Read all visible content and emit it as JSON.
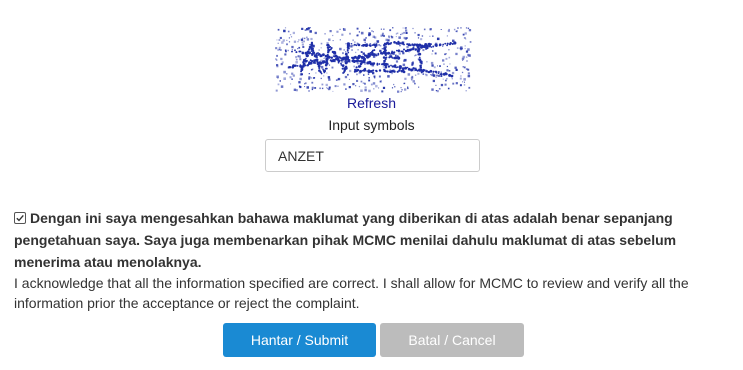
{
  "captcha": {
    "image_text": "ANZET",
    "refresh_label": "Refresh",
    "input_label": "Input symbols",
    "input_value": "ANZET",
    "noise_color": "#1f2fa8"
  },
  "acknowledgement": {
    "checked": true,
    "malay_text": "Dengan ini saya mengesahkan bahawa maklumat yang diberikan di atas adalah benar sepanjang pengetahuan saya. Saya juga membenarkan pihak MCMC menilai dahulu maklumat di atas sebelum menerima atau menolaknya.",
    "english_text": "I acknowledge that all the information specified are correct. I shall allow for MCMC to review and verify all the information prior the acceptance or reject the complaint."
  },
  "buttons": {
    "submit_label": "Hantar / Submit",
    "cancel_label": "Batal / Cancel",
    "submit_color": "#1a8ad3",
    "cancel_color": "#bcbcbc"
  }
}
